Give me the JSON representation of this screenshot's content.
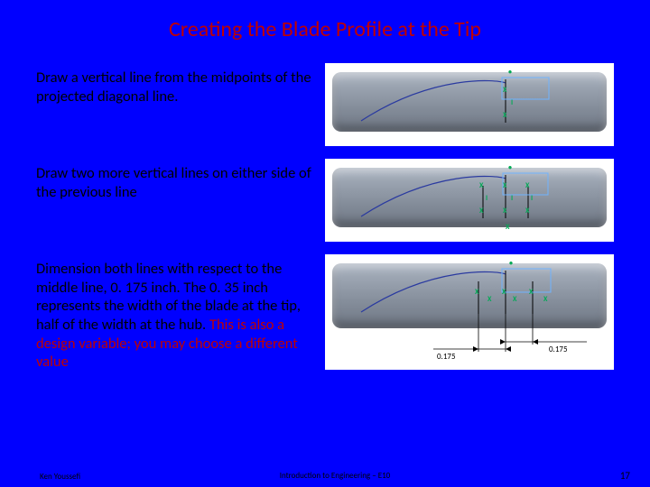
{
  "title": "Creating the Blade Profile at the Tip",
  "steps": [
    {
      "text": "Draw a vertical line from the midpoints of the projected diagonal line."
    },
    {
      "text": "Draw two more vertical lines on either side of the previous line"
    },
    {
      "text_a": "Dimension both lines with respect to the middle line, 0. 175 inch. The 0. 35  inch represents the width of the blade at the tip, half of the width at the hub. ",
      "text_b": "This is also a design variable; you may choose a different value"
    }
  ],
  "dims": {
    "left": "0.175",
    "right": "0.175"
  },
  "footer": {
    "left": "Ken Youssefi",
    "center": "Introduction to Engineering – E10",
    "page": "17"
  }
}
